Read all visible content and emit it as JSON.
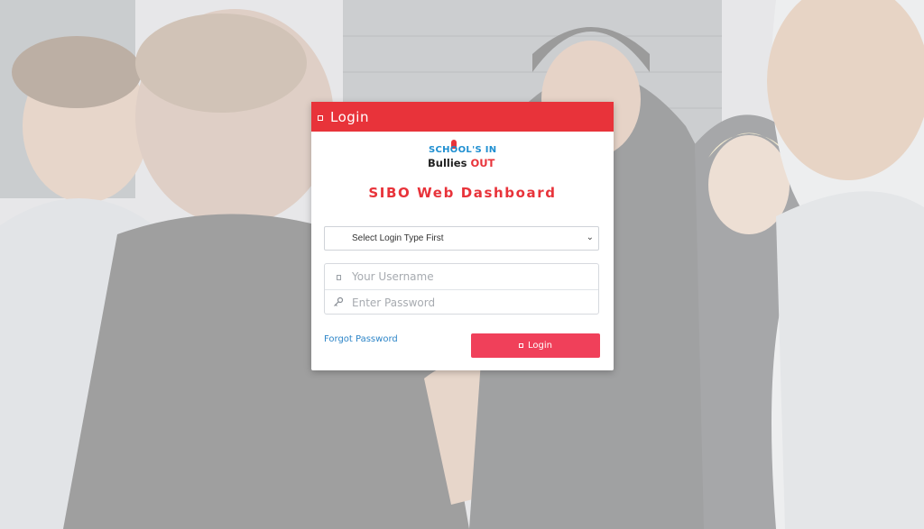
{
  "header": {
    "title": "Login",
    "icon": "login-icon"
  },
  "logo": {
    "line1": "SCHOOL'S IN",
    "line2_a": "Bullies ",
    "line2_b": "OUT"
  },
  "app_title": "SIBO Web Dashboard",
  "login_type_select": {
    "selected": "Select Login Type First",
    "options": [
      "Select Login Type First"
    ]
  },
  "username": {
    "placeholder": "Your Username",
    "value": "",
    "icon": "user-icon"
  },
  "password": {
    "placeholder": "Enter Password",
    "value": "",
    "icon": "key-icon"
  },
  "forgot_password": "Forgot Password",
  "login_button": {
    "label": "Login",
    "icon": "sign-in-icon"
  },
  "colors": {
    "accent": "#e8333a",
    "button": "#f0405a",
    "link": "#2f86c8"
  }
}
